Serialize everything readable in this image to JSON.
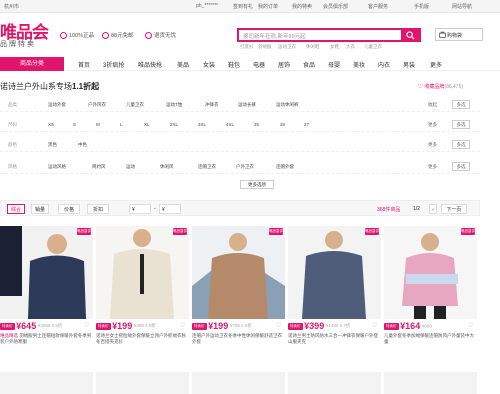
{
  "topbar": {
    "city": "杭州市",
    "user": "ph_*******",
    "items": [
      "签到有礼",
      "我的订单",
      "我的特卖",
      "会员俱乐部",
      "客户服务",
      "手机版",
      "网站导航"
    ]
  },
  "header": {
    "logo": "唯品会",
    "logo_sub": "品牌特卖",
    "badges": [
      "100%正品",
      "88元免邮",
      "退货无忧"
    ],
    "search_placeholder": "婆司新年狂欢,新年99元起",
    "hot": [
      "打底衫",
      "羽绒服",
      "运动卫衣",
      "休闲鞋",
      "女鞋",
      "大衣",
      "儿童卫衣"
    ],
    "cart": "购物袋"
  },
  "nav": {
    "category": "商品分类",
    "items": [
      "首页",
      "3折疯抢",
      "唯品快抢",
      "美品",
      "女装",
      "鞋包",
      "电器",
      "居饰",
      "食品",
      "母婴",
      "美妆",
      "内衣",
      "男装",
      "更多"
    ]
  },
  "brand": {
    "name": "诺诗兰户外山系专场",
    "discount": "1.1折起",
    "fav_label": "收藏品牌",
    "fav_count": "(86,475)"
  },
  "filters": [
    {
      "label": "品类",
      "values": [
        "运动外套",
        "户外风衣",
        "儿童卫衣",
        "运动T恤",
        "冲锋衣",
        "运动长裤",
        "运动休闲裤"
      ],
      "more": "收起",
      "multi": "多选"
    },
    {
      "label": "尺码",
      "values": [
        "XS",
        "S",
        "M",
        "L",
        "XL",
        "2XL",
        "3XL",
        "4XL",
        "25",
        "26",
        "27"
      ],
      "more": "更多",
      "multi": "多选"
    },
    {
      "label": "颜色",
      "values": [
        "黑色",
        "中色"
      ],
      "more": "更多",
      "multi": "多选"
    },
    {
      "label": "风格",
      "values": [
        "运动风格",
        "简约风",
        "运动",
        "休闲风",
        "连帽卫衣",
        "户外卫衣",
        "连帽外套"
      ],
      "more": "更多",
      "multi": "多选"
    }
  ],
  "more_options": "更多选项",
  "sortbar": {
    "items": [
      "综合",
      "销量",
      "价格",
      "折扣"
    ],
    "price_from": "¥",
    "price_to": "¥",
    "count_label": "368件商品",
    "page": "1/2",
    "next": "下一页"
  },
  "products": [
    {
      "tag": "唯品直供",
      "pricetag": "特卖价",
      "price": "¥645",
      "orig": "¥2599 2.5折",
      "desc": "羽绒服男士连帽短款保暖外套冬季男装户外防寒服",
      "extra": "唯品精选"
    },
    {
      "tag": "唯品直供",
      "pricetag": "特卖价",
      "price": "¥199",
      "orig": "¥498 4.0折",
      "desc": "诺诗兰女士摇粒绒外套保暖立领户外抓绒衣秋冬百搭夹克衫",
      "extra": ""
    },
    {
      "tag": "唯品直供",
      "pricetag": "特卖价",
      "price": "¥199",
      "orig": "¥798 2.5折",
      "desc": "连帽户外运动卫衣冬季中性休闲保暖舒适卫衣外套",
      "extra": ""
    },
    {
      "tag": "唯品直供",
      "pricetag": "特卖价",
      "price": "¥399",
      "orig": "¥1480 2.7折",
      "desc": "诺诗兰男士防风防水三合一冲锋衣保暖户外登山服夹克",
      "extra": ""
    },
    {
      "tag": "唯品直供",
      "pricetag": "特卖价",
      "price": "¥164",
      "orig": "¥699",
      "desc": "儿童外套冬季加绒保暖连帽防风户外童装中大童",
      "extra": ""
    }
  ]
}
